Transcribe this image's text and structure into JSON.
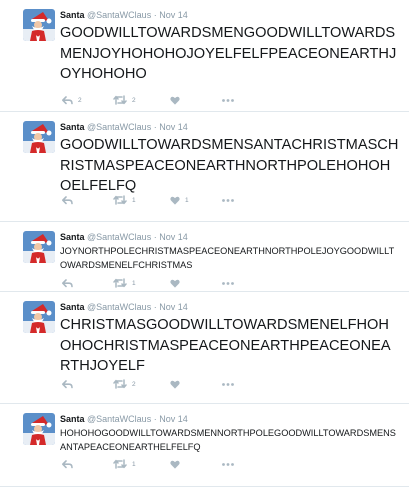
{
  "colors": {
    "background": "#e6ecf0",
    "card": "#ffffff",
    "text": "#14171a",
    "muted": "#8899a6",
    "icon": "#aab8c2"
  },
  "icons": {
    "reply": "reply-icon",
    "retweet": "retweet-icon",
    "like": "heart-icon",
    "more": "more-dots-icon",
    "avatar": "santa-avatar"
  },
  "tweets": [
    {
      "name": "Santa",
      "handle": "@SantaWClaus",
      "separator": "·",
      "date": "Nov 14",
      "text": "GOODWILLTOWARDSMENGOODWILLTOWARDSMENJOYHOHOHOJOYELFELFPEACEONEARTHJOYHOHOHO",
      "reply_count": "2",
      "retweet_count": "2",
      "like_count": ""
    },
    {
      "name": "Santa",
      "handle": "@SantaWClaus",
      "separator": "·",
      "date": "Nov 14",
      "text": "GOODWILLTOWARDSMENSANTACHRISTMASCHRISTMASPEACEONEARTHNORTHPOLEHOHOHOELFELFQ",
      "reply_count": "",
      "retweet_count": "1",
      "like_count": "1"
    },
    {
      "name": "Santa",
      "handle": "@SantaWClaus",
      "separator": "·",
      "date": "Nov 14",
      "text": "JOYNORTHPOLECHRISTMASPEACEONEARTHNORTHPOLEJOYGOODWILLTOWARDSMENELFCHRISTMAS",
      "reply_count": "",
      "retweet_count": "1",
      "like_count": ""
    },
    {
      "name": "Santa",
      "handle": "@SantaWClaus",
      "separator": "·",
      "date": "Nov 14",
      "text": "CHRISTMASGOODWILLTOWARDSMENELFHOHOHOCHRISTMASPEACEONEARTHPEACEONEARTHJOYELF",
      "reply_count": "",
      "retweet_count": "2",
      "like_count": ""
    },
    {
      "name": "Santa",
      "handle": "@SantaWClaus",
      "separator": "·",
      "date": "Nov 14",
      "text": "HOHOHOGOODWILLTOWARDSMENNORTHPOLEGOODWILLTOWARDSMENSANTAPEACEONEARTHELFELFQ",
      "reply_count": "",
      "retweet_count": "1",
      "like_count": ""
    }
  ]
}
